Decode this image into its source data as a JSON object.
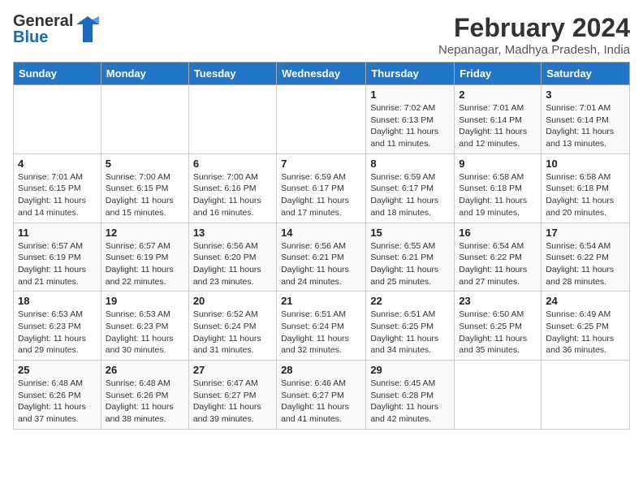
{
  "header": {
    "logo_general": "General",
    "logo_blue": "Blue",
    "month_year": "February 2024",
    "location": "Nepanagar, Madhya Pradesh, India"
  },
  "weekdays": [
    "Sunday",
    "Monday",
    "Tuesday",
    "Wednesday",
    "Thursday",
    "Friday",
    "Saturday"
  ],
  "weeks": [
    [
      {
        "day": "",
        "info": ""
      },
      {
        "day": "",
        "info": ""
      },
      {
        "day": "",
        "info": ""
      },
      {
        "day": "",
        "info": ""
      },
      {
        "day": "1",
        "info": "Sunrise: 7:02 AM\nSunset: 6:13 PM\nDaylight: 11 hours and 11 minutes."
      },
      {
        "day": "2",
        "info": "Sunrise: 7:01 AM\nSunset: 6:14 PM\nDaylight: 11 hours and 12 minutes."
      },
      {
        "day": "3",
        "info": "Sunrise: 7:01 AM\nSunset: 6:14 PM\nDaylight: 11 hours and 13 minutes."
      }
    ],
    [
      {
        "day": "4",
        "info": "Sunrise: 7:01 AM\nSunset: 6:15 PM\nDaylight: 11 hours and 14 minutes."
      },
      {
        "day": "5",
        "info": "Sunrise: 7:00 AM\nSunset: 6:15 PM\nDaylight: 11 hours and 15 minutes."
      },
      {
        "day": "6",
        "info": "Sunrise: 7:00 AM\nSunset: 6:16 PM\nDaylight: 11 hours and 16 minutes."
      },
      {
        "day": "7",
        "info": "Sunrise: 6:59 AM\nSunset: 6:17 PM\nDaylight: 11 hours and 17 minutes."
      },
      {
        "day": "8",
        "info": "Sunrise: 6:59 AM\nSunset: 6:17 PM\nDaylight: 11 hours and 18 minutes."
      },
      {
        "day": "9",
        "info": "Sunrise: 6:58 AM\nSunset: 6:18 PM\nDaylight: 11 hours and 19 minutes."
      },
      {
        "day": "10",
        "info": "Sunrise: 6:58 AM\nSunset: 6:18 PM\nDaylight: 11 hours and 20 minutes."
      }
    ],
    [
      {
        "day": "11",
        "info": "Sunrise: 6:57 AM\nSunset: 6:19 PM\nDaylight: 11 hours and 21 minutes."
      },
      {
        "day": "12",
        "info": "Sunrise: 6:57 AM\nSunset: 6:19 PM\nDaylight: 11 hours and 22 minutes."
      },
      {
        "day": "13",
        "info": "Sunrise: 6:56 AM\nSunset: 6:20 PM\nDaylight: 11 hours and 23 minutes."
      },
      {
        "day": "14",
        "info": "Sunrise: 6:56 AM\nSunset: 6:21 PM\nDaylight: 11 hours and 24 minutes."
      },
      {
        "day": "15",
        "info": "Sunrise: 6:55 AM\nSunset: 6:21 PM\nDaylight: 11 hours and 25 minutes."
      },
      {
        "day": "16",
        "info": "Sunrise: 6:54 AM\nSunset: 6:22 PM\nDaylight: 11 hours and 27 minutes."
      },
      {
        "day": "17",
        "info": "Sunrise: 6:54 AM\nSunset: 6:22 PM\nDaylight: 11 hours and 28 minutes."
      }
    ],
    [
      {
        "day": "18",
        "info": "Sunrise: 6:53 AM\nSunset: 6:23 PM\nDaylight: 11 hours and 29 minutes."
      },
      {
        "day": "19",
        "info": "Sunrise: 6:53 AM\nSunset: 6:23 PM\nDaylight: 11 hours and 30 minutes."
      },
      {
        "day": "20",
        "info": "Sunrise: 6:52 AM\nSunset: 6:24 PM\nDaylight: 11 hours and 31 minutes."
      },
      {
        "day": "21",
        "info": "Sunrise: 6:51 AM\nSunset: 6:24 PM\nDaylight: 11 hours and 32 minutes."
      },
      {
        "day": "22",
        "info": "Sunrise: 6:51 AM\nSunset: 6:25 PM\nDaylight: 11 hours and 34 minutes."
      },
      {
        "day": "23",
        "info": "Sunrise: 6:50 AM\nSunset: 6:25 PM\nDaylight: 11 hours and 35 minutes."
      },
      {
        "day": "24",
        "info": "Sunrise: 6:49 AM\nSunset: 6:25 PM\nDaylight: 11 hours and 36 minutes."
      }
    ],
    [
      {
        "day": "25",
        "info": "Sunrise: 6:48 AM\nSunset: 6:26 PM\nDaylight: 11 hours and 37 minutes."
      },
      {
        "day": "26",
        "info": "Sunrise: 6:48 AM\nSunset: 6:26 PM\nDaylight: 11 hours and 38 minutes."
      },
      {
        "day": "27",
        "info": "Sunrise: 6:47 AM\nSunset: 6:27 PM\nDaylight: 11 hours and 39 minutes."
      },
      {
        "day": "28",
        "info": "Sunrise: 6:46 AM\nSunset: 6:27 PM\nDaylight: 11 hours and 41 minutes."
      },
      {
        "day": "29",
        "info": "Sunrise: 6:45 AM\nSunset: 6:28 PM\nDaylight: 11 hours and 42 minutes."
      },
      {
        "day": "",
        "info": ""
      },
      {
        "day": "",
        "info": ""
      }
    ]
  ]
}
